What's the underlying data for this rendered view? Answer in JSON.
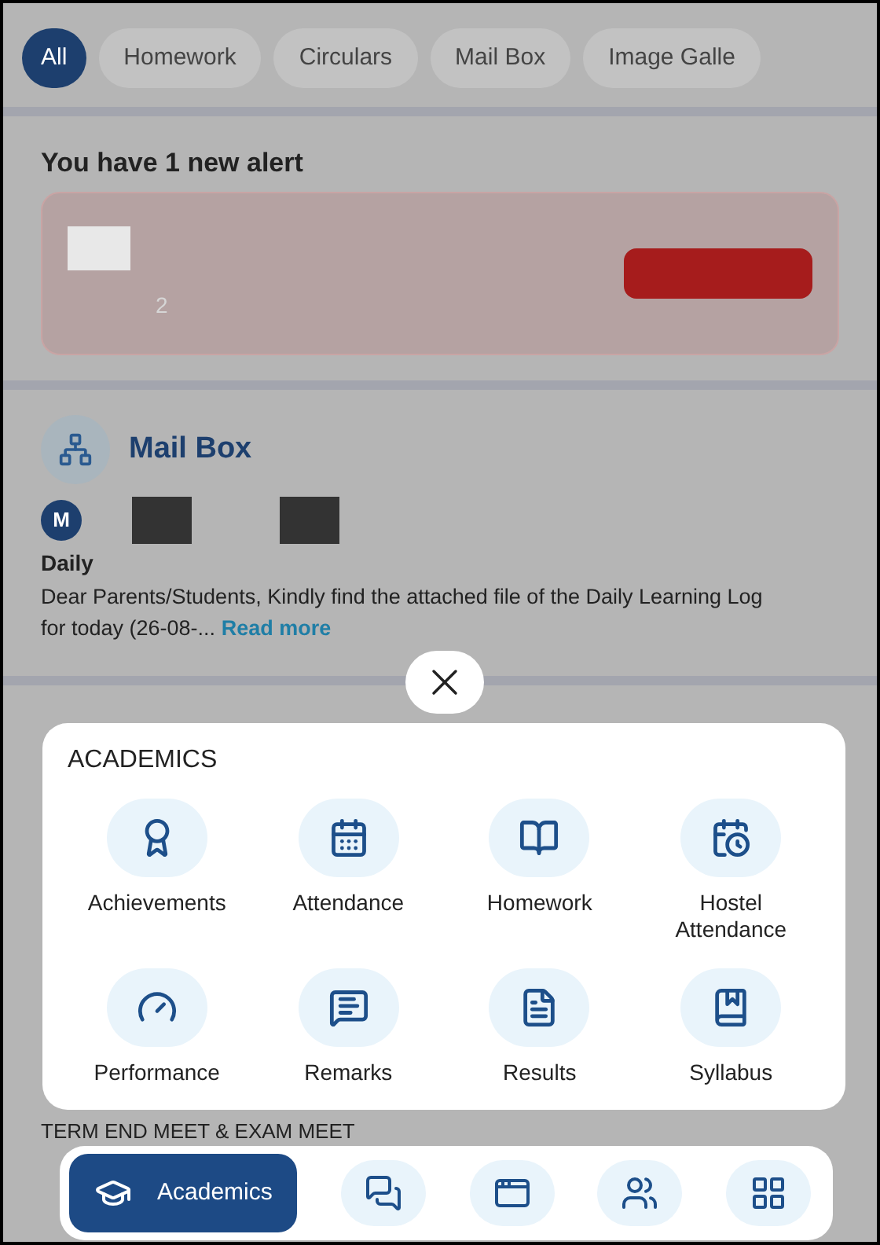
{
  "filter_chips": [
    {
      "label": "All",
      "selected": true
    },
    {
      "label": "Homework",
      "selected": false
    },
    {
      "label": "Circulars",
      "selected": false
    },
    {
      "label": "Mail Box",
      "selected": false
    },
    {
      "label": "Image Galle",
      "selected": false
    }
  ],
  "alert": {
    "title": "You have 1 new alert",
    "text": "2"
  },
  "post": {
    "title": "Mail Box",
    "avatar_letter": "M",
    "sender": "Daily",
    "body": "Dear Parents/Students, Kindly find the attached file of the Daily Learning Log for today (26-08-...",
    "link": "Read more"
  },
  "next_post": {
    "title": "TERM END MEET & EXAM MEET"
  },
  "menu": {
    "title": "ACADEMICS",
    "items": [
      {
        "label": "Achievements",
        "kind": "achievements"
      },
      {
        "label": "Attendance",
        "kind": "attendance"
      },
      {
        "label": "Homework",
        "kind": "homework"
      },
      {
        "label": "Hostel Attendance",
        "kind": "hostel"
      },
      {
        "label": "Performance",
        "kind": "performance"
      },
      {
        "label": "Remarks",
        "kind": "remarks"
      },
      {
        "label": "Results",
        "kind": "results"
      },
      {
        "label": "Syllabus",
        "kind": "syllabus"
      }
    ]
  },
  "bottom_nav": [
    {
      "label": "Academics",
      "kind": "academics",
      "selected": true
    },
    {
      "kind": "chat",
      "selected": false
    },
    {
      "kind": "screen",
      "selected": false
    },
    {
      "kind": "people",
      "selected": false
    },
    {
      "kind": "grid",
      "selected": false
    }
  ]
}
